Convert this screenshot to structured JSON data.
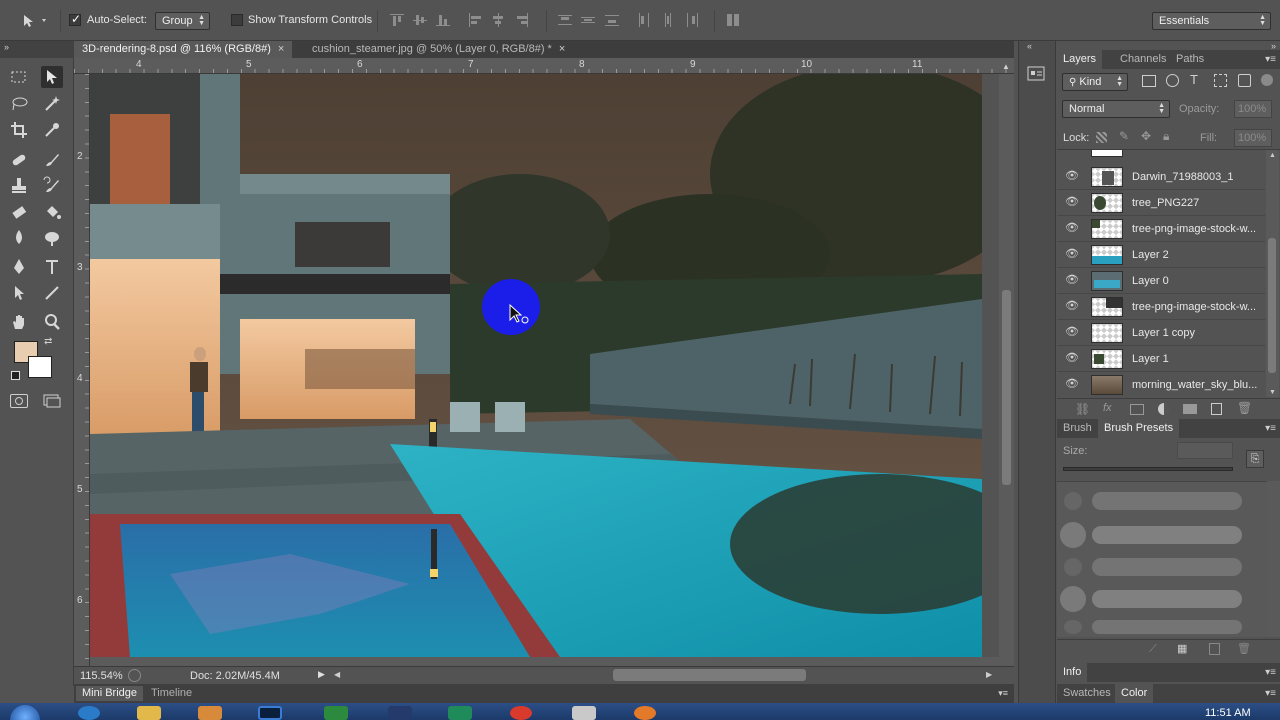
{
  "options_bar": {
    "auto_select_label": "Auto-Select:",
    "auto_select_checked": true,
    "auto_select_target": "Group",
    "transform_controls_label": "Show Transform Controls",
    "transform_controls_checked": false,
    "workspace": "Essentials"
  },
  "tabs": [
    {
      "label": "3D-rendering-8.psd @ 116% (RGB/8#)",
      "close": "×",
      "active": true
    },
    {
      "label": "cushion_steamer.jpg @ 50% (Layer 0, RGB/8#) *",
      "close": "×",
      "active": false
    }
  ],
  "rulers": {
    "top": [
      "4",
      "5",
      "6",
      "7",
      "8",
      "9",
      "10",
      "11"
    ],
    "left": [
      "2",
      "3",
      "4",
      "5",
      "6"
    ]
  },
  "toolbox": {
    "icons": [
      "move-tool-icon",
      "marquee-tool-icon",
      "lasso-tool-icon",
      "magic-wand-icon",
      "crop-tool-icon",
      "eyedropper-icon",
      "healing-brush-icon",
      "brush-tool-icon",
      "clone-stamp-icon",
      "history-brush-icon",
      "eraser-icon",
      "paint-bucket-icon",
      "blur-tool-icon",
      "dodge-tool-icon",
      "pen-tool-icon",
      "type-tool-icon",
      "path-selection-icon",
      "line-tool-icon",
      "hand-tool-icon",
      "zoom-tool-icon"
    ],
    "foreground_color": "#e8cdb0",
    "background_color": "#ffffff"
  },
  "status": {
    "zoom": "115.54%",
    "doc": "Doc: 2.02M/45.4M"
  },
  "bottom_tabs": [
    "Mini Bridge",
    "Timeline"
  ],
  "layers_panel": {
    "tabs": [
      "Layers",
      "Channels",
      "Paths"
    ],
    "filter_kind": "Kind",
    "blend_mode": "Normal",
    "opacity_label": "Opacity:",
    "opacity_value": "100%",
    "lock_label": "Lock:",
    "fill_label": "Fill:",
    "fill_value": "100%",
    "layers": [
      {
        "name": "Darwin_71988003_1",
        "visible": true
      },
      {
        "name": "tree_PNG227",
        "visible": true
      },
      {
        "name": "tree-png-image-stock-w...",
        "visible": true
      },
      {
        "name": "Layer 2",
        "visible": true
      },
      {
        "name": "Layer 0",
        "visible": true
      },
      {
        "name": "tree-png-image-stock-w...",
        "visible": true
      },
      {
        "name": "Layer 1 copy",
        "visible": true
      },
      {
        "name": "Layer 1",
        "visible": true
      },
      {
        "name": "morning_water_sky_blu...",
        "visible": true
      }
    ]
  },
  "brush_panel": {
    "tabs": [
      "Brush",
      "Brush Presets"
    ],
    "size_label": "Size:"
  },
  "info_panel": {
    "tabs": [
      "Info"
    ]
  },
  "color_panel": {
    "tabs": [
      "Swatches",
      "Color"
    ]
  },
  "taskbar": {
    "time": "11:51 AM"
  }
}
